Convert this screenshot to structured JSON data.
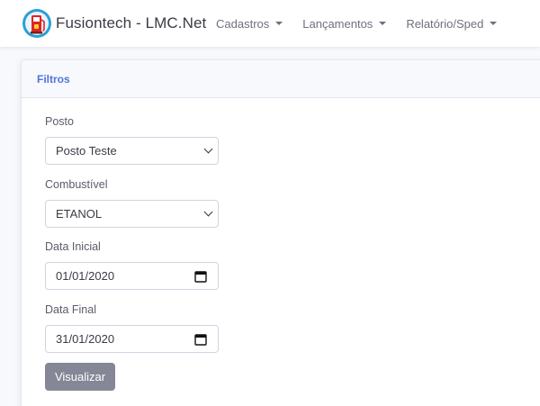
{
  "app": {
    "title": "Fusiontech - LMC.Net",
    "logo_icon": "fuel-pump-logo-icon"
  },
  "nav": {
    "items": [
      {
        "label": "Cadastros"
      },
      {
        "label": "Lançamentos"
      },
      {
        "label": "Relatório/Sped"
      }
    ]
  },
  "card": {
    "title": "Filtros"
  },
  "form": {
    "posto": {
      "label": "Posto",
      "value": "Posto Teste"
    },
    "combustivel": {
      "label": "Combustível",
      "value": "ETANOL"
    },
    "data_inicial": {
      "label": "Data Inicial",
      "value": "01/01/2020"
    },
    "data_final": {
      "label": "Data Final",
      "value": "31/01/2020"
    },
    "submit_label": "Visualizar"
  },
  "colors": {
    "primary": "#4e73df",
    "secondary_button": "#858796",
    "logo_red": "#e02424",
    "logo_ring": "#2a9fd6"
  }
}
